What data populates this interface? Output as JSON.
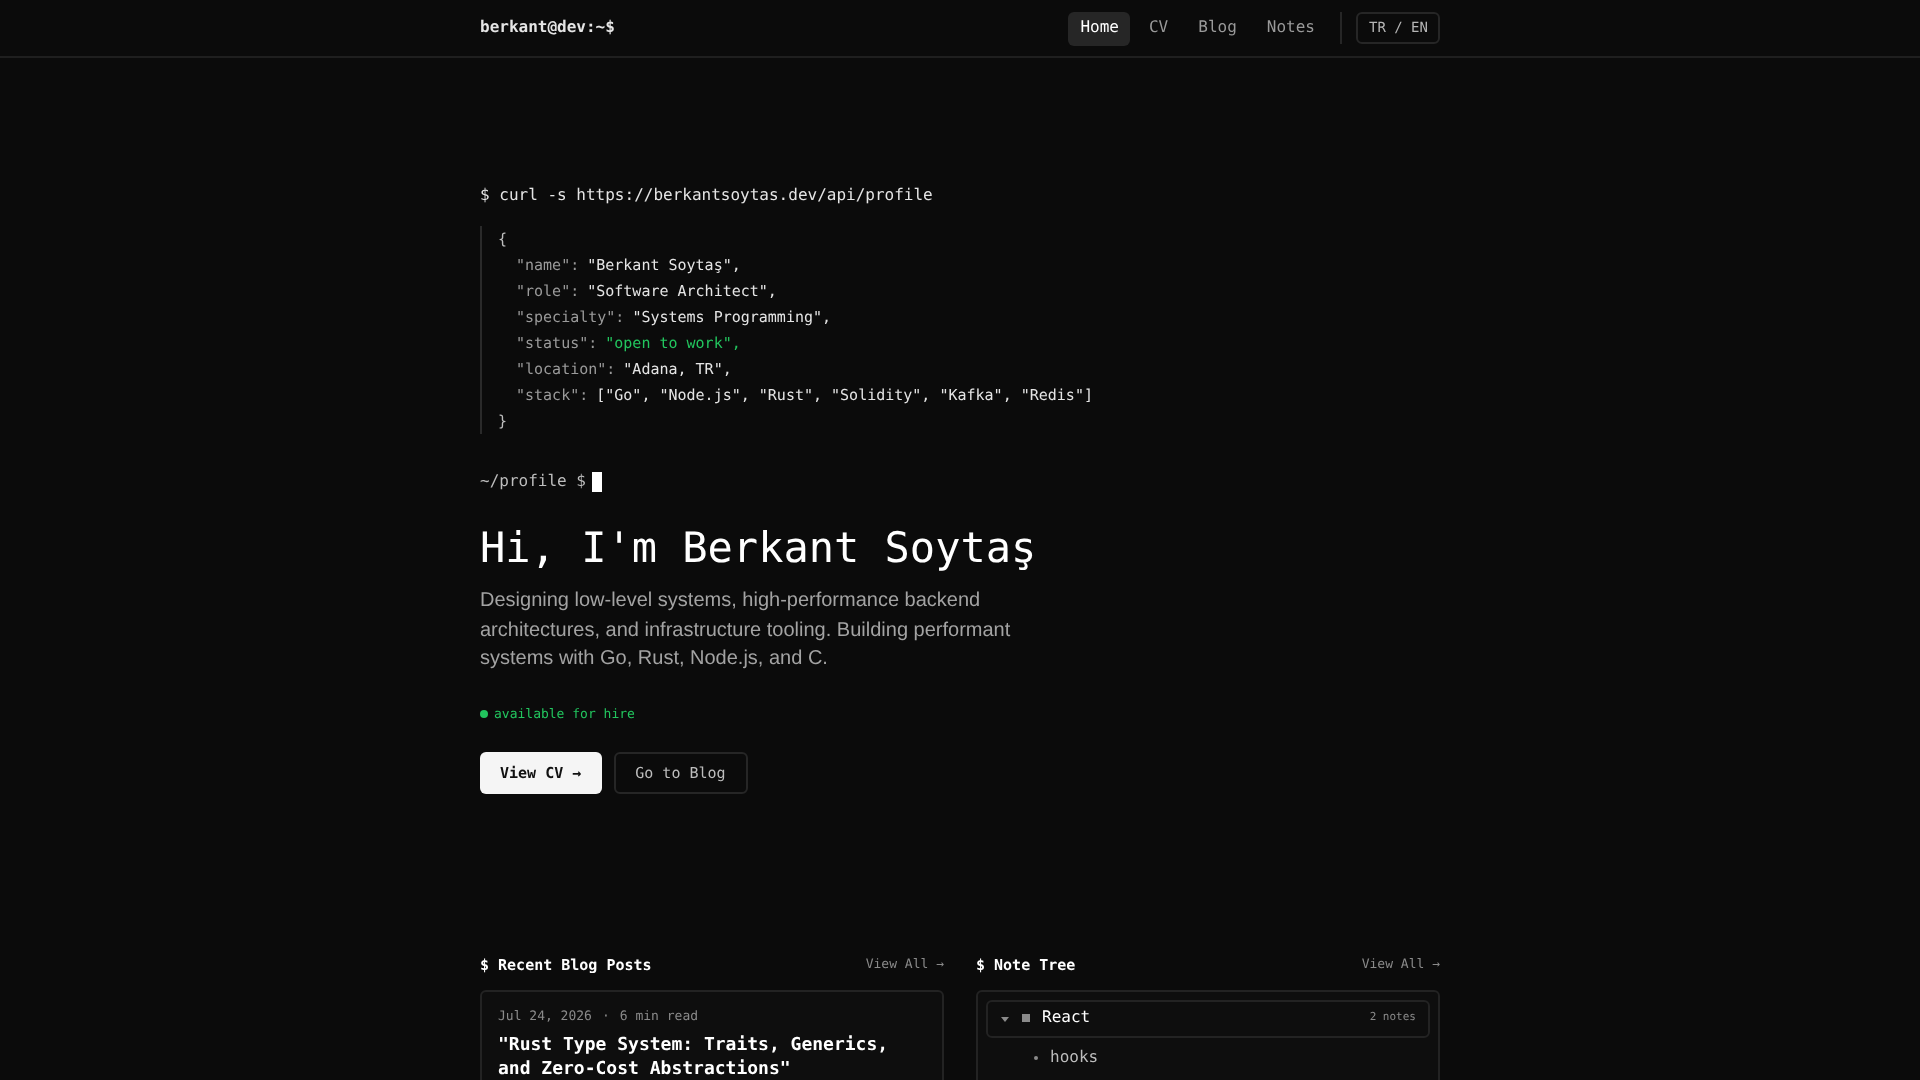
{
  "header": {
    "prompt": "berkant@dev:~$",
    "nav": [
      {
        "label": "Home",
        "selected": true
      },
      {
        "label": "CV",
        "selected": false
      },
      {
        "label": "Blog",
        "selected": false
      },
      {
        "label": "Notes",
        "selected": false
      }
    ],
    "language": "TR / EN"
  },
  "terminal": {
    "command": "$ curl -s https://berkantsoytas.dev/api/profile",
    "open_brace": "{",
    "lines": [
      {
        "key": "\"name\":",
        "value": "\"Berkant Soytaş\",",
        "kind": "plain"
      },
      {
        "key": "\"role\":",
        "value": "\"Software Architect\",",
        "kind": "plain"
      },
      {
        "key": "\"specialty\":",
        "value": "\"Systems Programming\",",
        "kind": "plain"
      },
      {
        "key": "\"status\":",
        "value": "\"open to work\",",
        "kind": "highlight"
      },
      {
        "key": "\"location\":",
        "value": "\"Adana, TR\",",
        "kind": "plain"
      },
      {
        "key": "\"stack\":",
        "value": "[\"Go\", \"Node.js\", \"Rust\", \"Solidity\", \"Kafka\", \"Redis\"]",
        "kind": "plain"
      }
    ],
    "close_brace": "}",
    "prompt": "~/profile $"
  },
  "hero": {
    "title": "Hi, I'm Berkant Soytaş",
    "description": "Designing low-level systems, high-performance backend architectures, and infrastructure tooling. Building performant systems with Go, Rust, Node.js, and C.",
    "availability": "available for hire",
    "buttons": [
      {
        "label": "View CV →",
        "kind": "primary"
      },
      {
        "label": "Go to Blog",
        "kind": "secondary"
      }
    ]
  },
  "blog": {
    "title": "$ Recent Blog Posts",
    "view_all": "View All →",
    "posts": [
      {
        "date": "Jul 24, 2026",
        "separator": "·",
        "read_time": "6 min read",
        "title": "\"Rust Type System: Traits, Generics, and Zero-Cost Abstractions\""
      }
    ]
  },
  "notes": {
    "title": "$ Note Tree",
    "view_all": "View All →",
    "tree": [
      {
        "label": "React",
        "count": "2 notes",
        "expanded": true,
        "children": [
          {
            "label": "hooks"
          }
        ]
      }
    ]
  }
}
